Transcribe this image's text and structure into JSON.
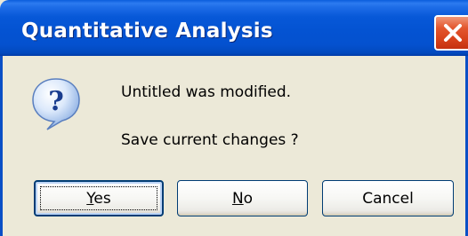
{
  "window": {
    "title": "Quantitative Analysis"
  },
  "icons": {
    "title_close": "close-icon",
    "message": "question-icon"
  },
  "message": {
    "line1": "Untitled was modified.",
    "line2": "Save current changes ?"
  },
  "buttons": {
    "yes": {
      "mnemonic": "Y",
      "rest": "es"
    },
    "no": {
      "mnemonic": "N",
      "rest": "o"
    },
    "cancel": {
      "label": "Cancel"
    }
  },
  "colors": {
    "titlebar": "#0453d2",
    "close_button": "#d8421b",
    "dialog_background": "#ece9d8",
    "button_border": "#003c74"
  }
}
